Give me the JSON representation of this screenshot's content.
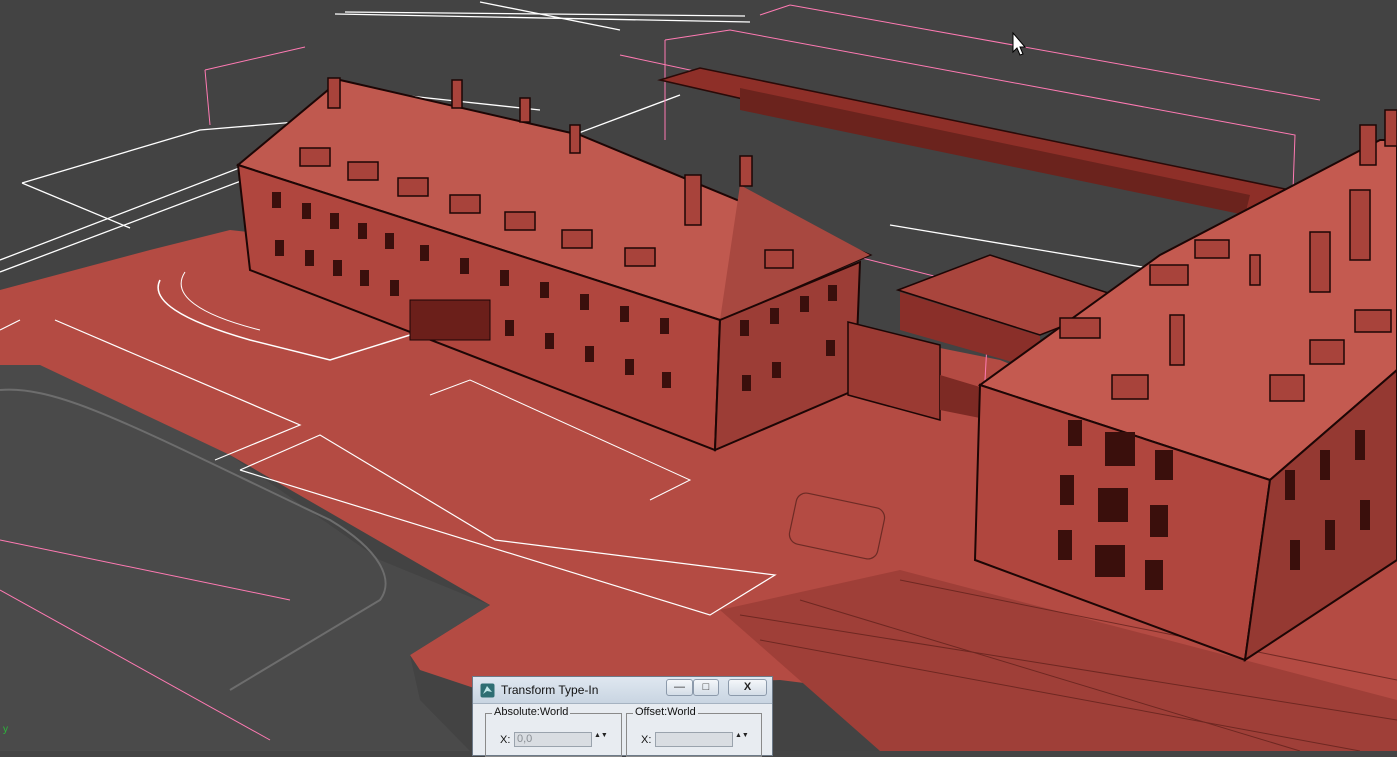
{
  "viewport": {
    "scene": "3D perspective viewport with red-shaded building models"
  },
  "dialog": {
    "title": "Transform Type-In",
    "minimize_glyph": "—",
    "maximize_glyph": "□",
    "close_glyph": "X",
    "absolute_group": {
      "label": "Absolute:World",
      "axis": "X:",
      "value": "0,0"
    },
    "offset_group": {
      "label": "Offset:World",
      "axis": "X:",
      "value": ""
    },
    "spinner_glyph": "▲▼"
  },
  "gizmo": {
    "label": "y"
  },
  "icons": [
    "app-3dsmax-icon",
    "minimize-icon",
    "maximize-icon",
    "close-icon",
    "spinner-icon",
    "mouse-cursor-icon"
  ],
  "colors": {
    "viewport_bg": "#444444",
    "model_red": "#b84d44",
    "wire_pink": "#ff7ab3",
    "wire_white": "#ffffff",
    "dialog_bg": "#e8ecf1"
  }
}
